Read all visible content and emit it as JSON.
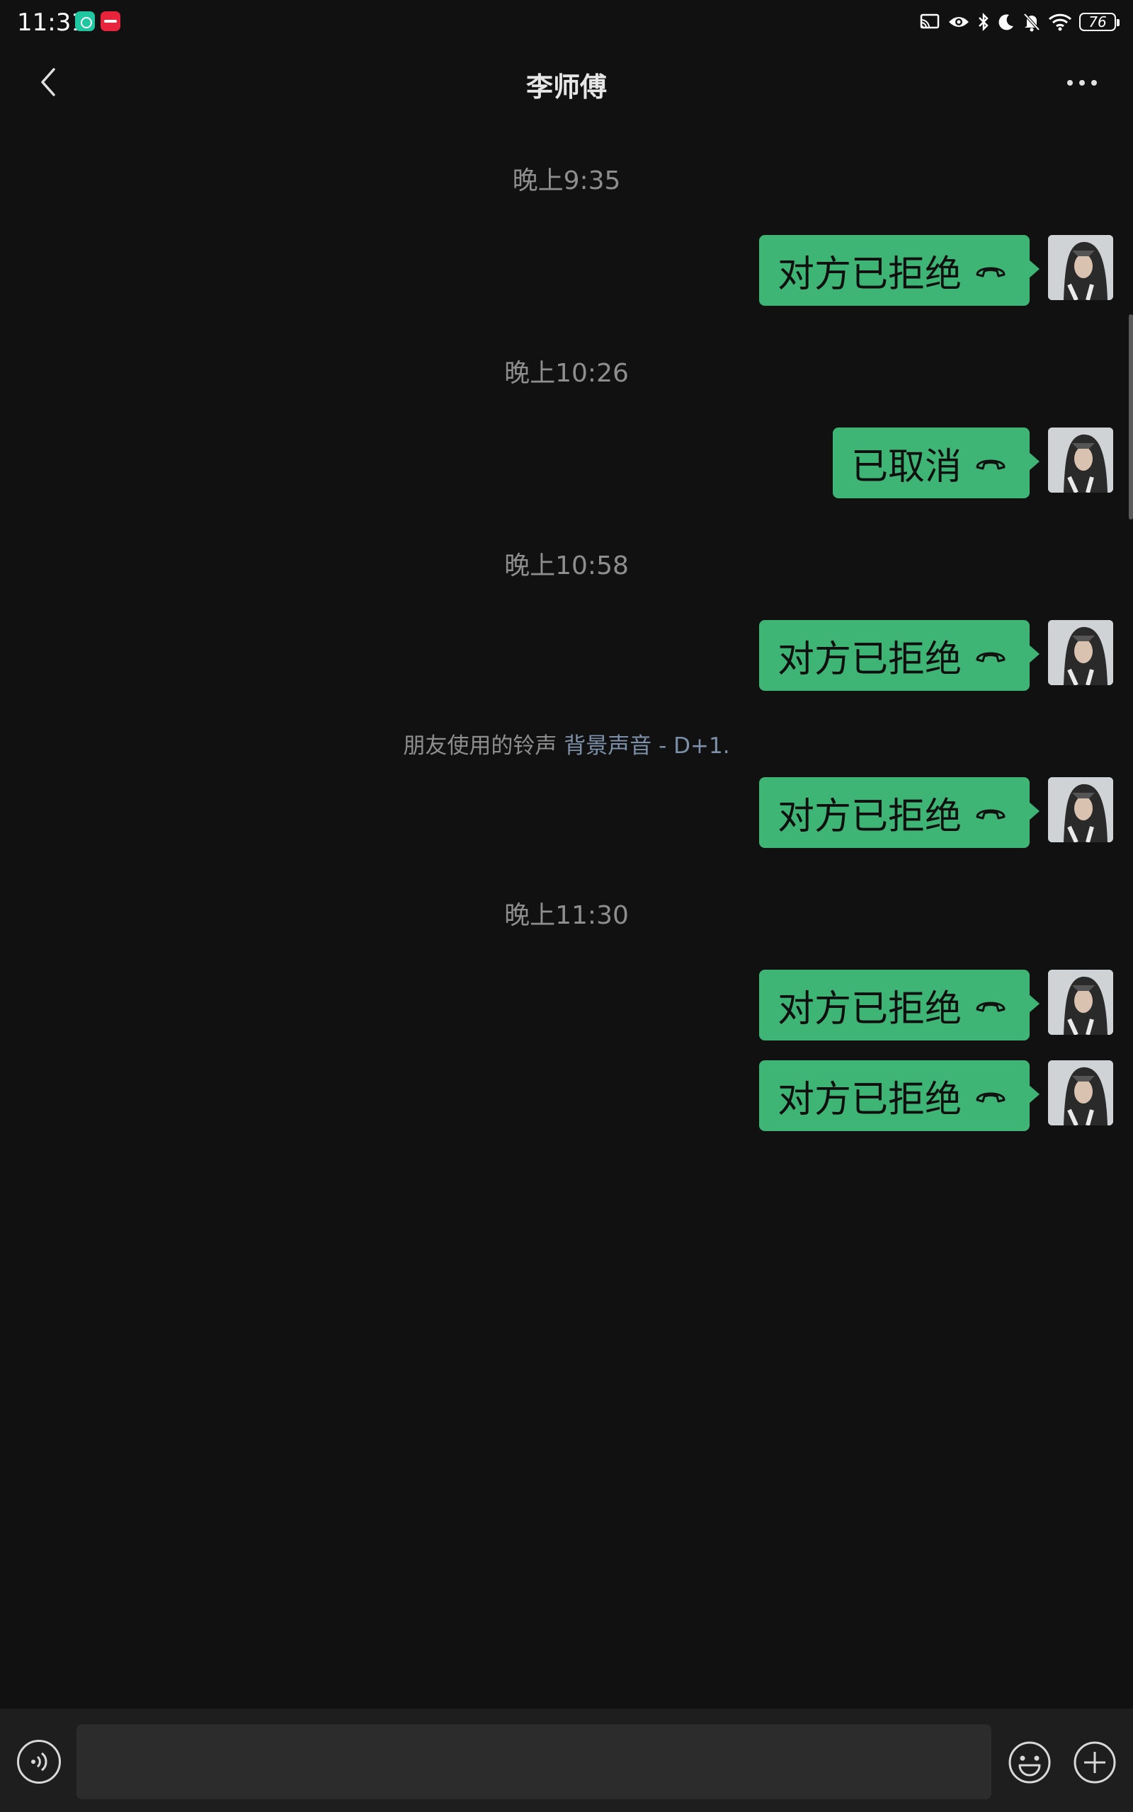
{
  "status_bar": {
    "time": "11:31",
    "battery": "76",
    "icons": [
      "cast-icon",
      "eye-icon",
      "bluetooth-icon",
      "moon-icon",
      "mute-bell-icon",
      "wifi-icon",
      "battery-icon"
    ]
  },
  "header": {
    "title": "李师傅",
    "back_icon": "chevron-left-icon",
    "more_icon": "more-dots-icon"
  },
  "messages": [
    {
      "type": "timestamp",
      "text": "晚上9:35"
    },
    {
      "type": "call",
      "from": "me",
      "text": "对方已拒绝",
      "icon": "hangup-icon"
    },
    {
      "type": "timestamp",
      "text": "晚上10:26"
    },
    {
      "type": "call",
      "from": "me",
      "text": "已取消",
      "icon": "hangup-icon"
    },
    {
      "type": "timestamp",
      "text": "晚上10:58"
    },
    {
      "type": "call",
      "from": "me",
      "text": "对方已拒绝",
      "icon": "hangup-icon"
    },
    {
      "type": "system",
      "prefix": "朋友使用的铃声",
      "link": "背景声音 - D+1."
    },
    {
      "type": "call",
      "from": "me",
      "text": "对方已拒绝",
      "icon": "hangup-icon"
    },
    {
      "type": "timestamp",
      "text": "晚上11:30"
    },
    {
      "type": "call",
      "from": "me",
      "text": "对方已拒绝",
      "icon": "hangup-icon"
    },
    {
      "type": "call",
      "from": "me",
      "text": "对方已拒绝",
      "icon": "hangup-icon"
    }
  ],
  "input_bar": {
    "voice_icon": "voice-icon",
    "text_value": "",
    "emoji_icon": "emoji-icon",
    "plus_icon": "plus-circle-icon"
  },
  "colors": {
    "background": "#111111",
    "bubble": "#3eb575",
    "timestamp": "#8e8e8e",
    "link": "#7d90a9",
    "input_bar": "#1e1e1e"
  }
}
